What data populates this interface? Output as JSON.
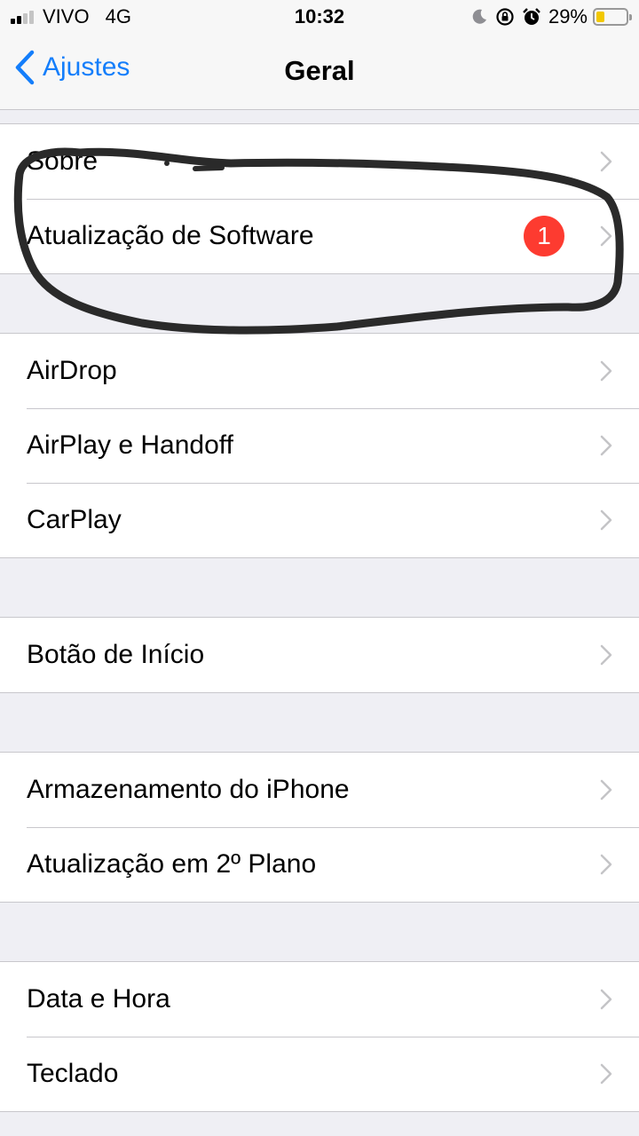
{
  "status_bar": {
    "carrier": "VIVO",
    "network": "4G",
    "time": "10:32",
    "battery_percent": "29%",
    "battery_level": 0.29,
    "icons": [
      "signal-icon",
      "moon-icon",
      "orientation-lock-icon",
      "alarm-icon",
      "battery-icon"
    ]
  },
  "nav": {
    "back_label": "Ajustes",
    "title": "Geral"
  },
  "groups": [
    {
      "rows": [
        {
          "label": "Sobre"
        },
        {
          "label": "Atualização de Software",
          "badge": "1"
        }
      ]
    },
    {
      "rows": [
        {
          "label": "AirDrop"
        },
        {
          "label": "AirPlay e Handoff"
        },
        {
          "label": "CarPlay"
        }
      ]
    },
    {
      "rows": [
        {
          "label": "Botão de Início"
        }
      ]
    },
    {
      "rows": [
        {
          "label": "Armazenamento do iPhone"
        },
        {
          "label": "Atualização em 2º Plano"
        }
      ]
    },
    {
      "rows": [
        {
          "label": "Data e Hora"
        },
        {
          "label": "Teclado"
        }
      ]
    }
  ],
  "colors": {
    "accent": "#147efb",
    "badge": "#fd3b30",
    "background": "#efeff4",
    "battery": "#f2c800",
    "annotation": "#2a2a2a"
  }
}
